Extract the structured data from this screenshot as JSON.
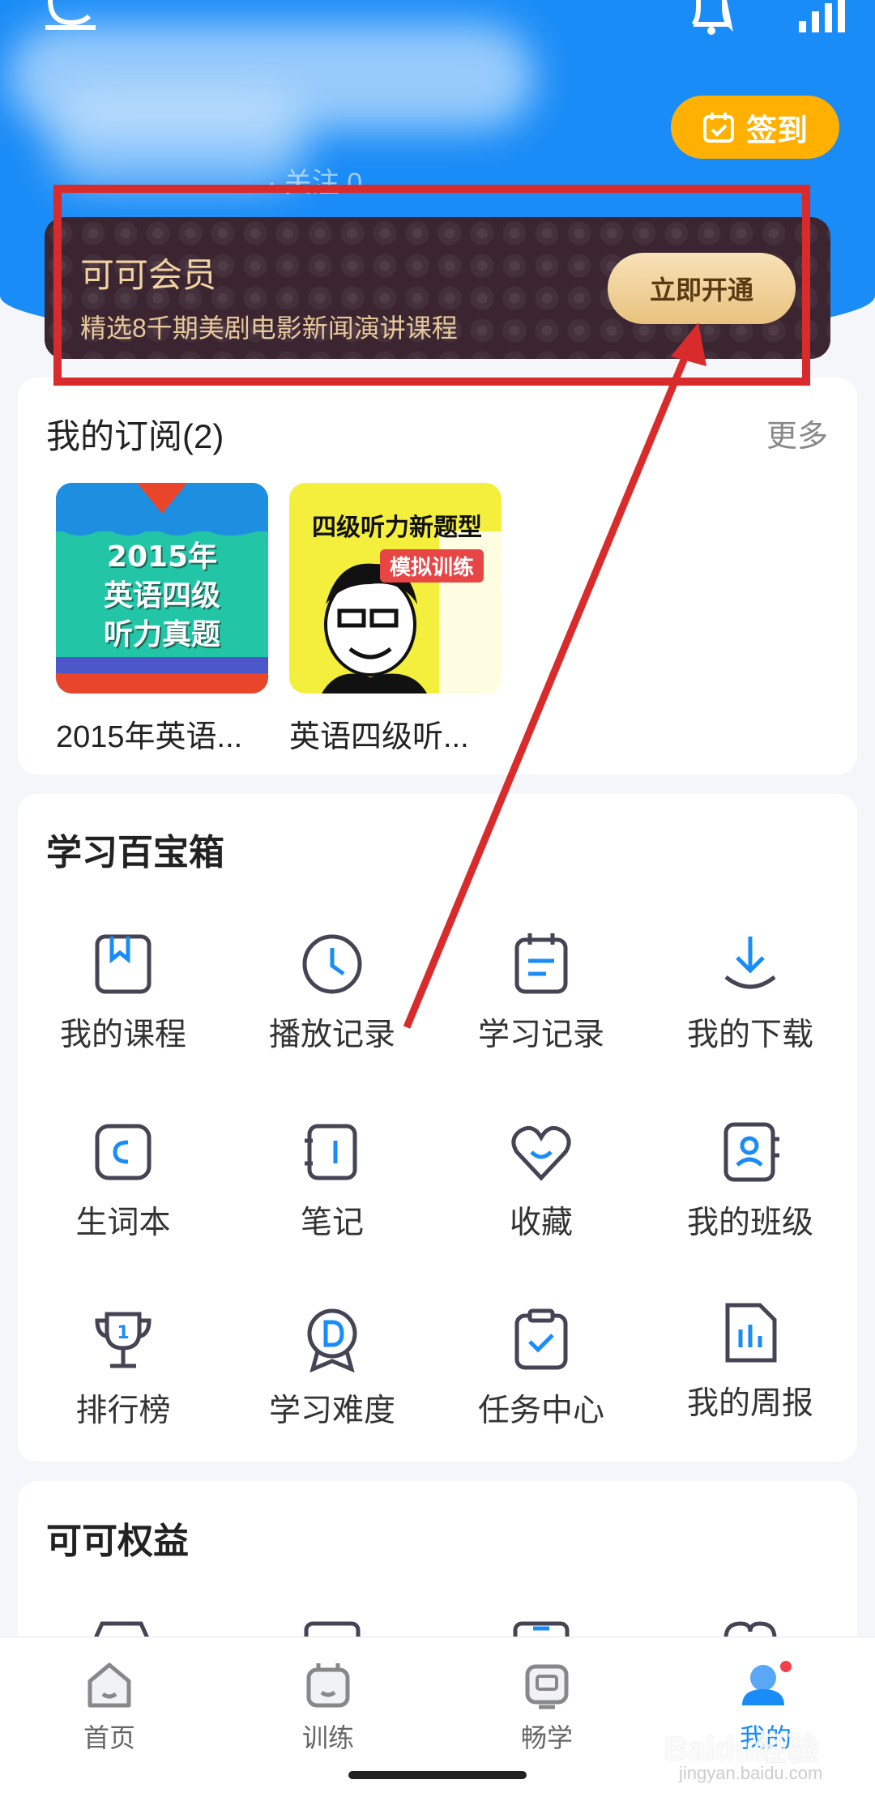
{
  "header": {
    "sub_text": "· 关注 0",
    "checkin_label": "签到"
  },
  "vip": {
    "title": "可可会员",
    "subtitle": "精选8千期美剧电影新闻演讲课程",
    "button": "立即开通"
  },
  "subscriptions": {
    "title": "我的订阅(2)",
    "more": "更多",
    "items": [
      {
        "name": "2015年英语...",
        "cover_lines": [
          "2015年",
          "英语四级",
          "听力真题"
        ]
      },
      {
        "name": "英语四级听...",
        "cover_title": "四级听力新题型",
        "cover_tag": "模拟训练"
      }
    ]
  },
  "toolbox": {
    "title": "学习百宝箱",
    "items": [
      {
        "label": "我的课程",
        "icon": "bookmark-book-icon"
      },
      {
        "label": "播放记录",
        "icon": "clock-icon"
      },
      {
        "label": "学习记录",
        "icon": "calendar-note-icon"
      },
      {
        "label": "我的下载",
        "icon": "download-icon"
      },
      {
        "label": "生词本",
        "icon": "vocabulary-book-icon"
      },
      {
        "label": "笔记",
        "icon": "notebook-icon"
      },
      {
        "label": "收藏",
        "icon": "heart-icon"
      },
      {
        "label": "我的班级",
        "icon": "class-contact-icon"
      },
      {
        "label": "排行榜",
        "icon": "trophy-icon"
      },
      {
        "label": "学习难度",
        "icon": "difficulty-badge-icon"
      },
      {
        "label": "任务中心",
        "icon": "task-check-icon"
      },
      {
        "label": "我的周报",
        "icon": "weekly-report-icon"
      }
    ]
  },
  "rights": {
    "title": "可可权益"
  },
  "tabbar": [
    {
      "label": "首页",
      "icon": "home-icon"
    },
    {
      "label": "训练",
      "icon": "train-icon"
    },
    {
      "label": "畅学",
      "icon": "tv-icon"
    },
    {
      "label": "我的",
      "icon": "profile-icon",
      "active": true
    }
  ],
  "watermark": {
    "brand": "Baidu经验",
    "url": "jingyan.baidu.com"
  },
  "colors": {
    "primary": "#1a8cf7",
    "checkin": "#ffb000",
    "highlight": "#d92b2b",
    "vip_bg": "#3a2530"
  }
}
